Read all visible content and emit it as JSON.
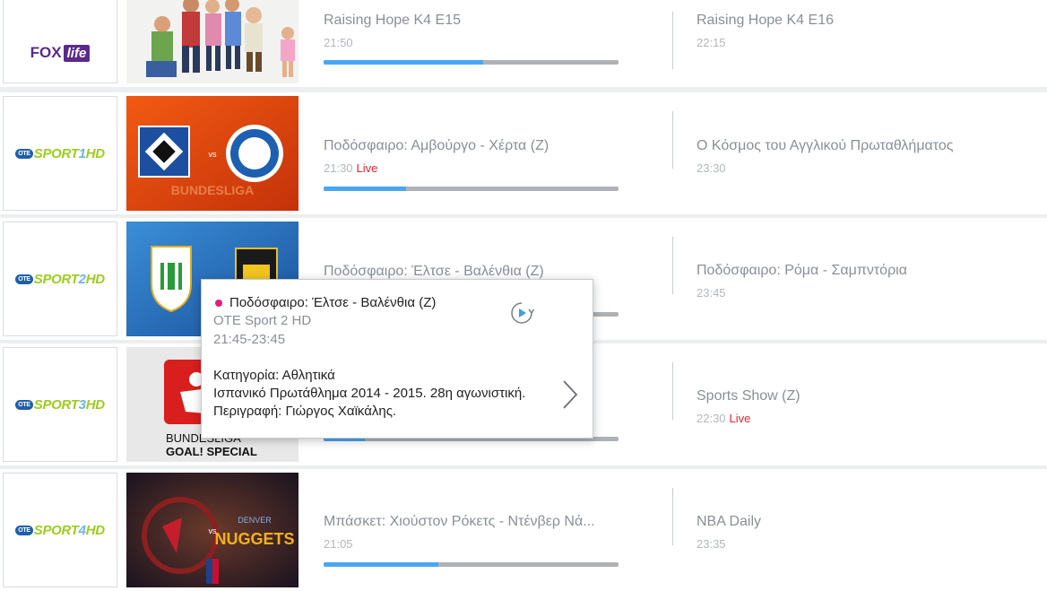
{
  "rows": [
    {
      "channel": "FOX life",
      "logo_type": "fox",
      "current": {
        "title": "Raising Hope K4 E15",
        "time": "21:50",
        "live": "",
        "progress": 0.54
      },
      "next": {
        "title": "Raising Hope K4 E16",
        "time": "22:15",
        "live": ""
      }
    },
    {
      "channel": "OTE SPORT 1 HD",
      "logo_type": "sport",
      "logo_num": "1",
      "current": {
        "title": "Ποδόσφαιρο: Αμβούργο - Χέρτα (Ζ)",
        "time": "21:30",
        "live": "Live",
        "progress": 0.28
      },
      "next": {
        "title": "Ο Κόσμος του Αγγλικού Πρωταθλήματος",
        "time": "23:30",
        "live": ""
      }
    },
    {
      "channel": "OTE SPORT 2 HD",
      "logo_type": "sport",
      "logo_num": "2",
      "current": {
        "title": "Ποδόσφαιρο: Έλτσε - Βαλένθια (Ζ)",
        "time": "",
        "live": "",
        "progress": 0.5
      },
      "next": {
        "title": "Ποδόσφαιρο: Ρόμα - Σαμπντόρια",
        "time": "23:45",
        "live": ""
      }
    },
    {
      "channel": "OTE SPORT 3 HD",
      "logo_type": "sport",
      "logo_num": "3",
      "current": {
        "title": "",
        "time": "",
        "live": "",
        "progress": 0.14
      },
      "next": {
        "title": "Sports Show (Ζ)",
        "time": "22:30",
        "live": "Live"
      }
    },
    {
      "channel": "OTE SPORT 4 HD",
      "logo_type": "sport",
      "logo_num": "4",
      "current": {
        "title": "Μπάσκετ: Χιούστον Ρόκετς - Ντένβερ Νά...",
        "time": "21:05",
        "live": "",
        "progress": 0.39
      },
      "next": {
        "title": "NBA Daily",
        "time": "23:35",
        "live": ""
      }
    }
  ],
  "logo_text": {
    "fox": "FOX",
    "life": "life",
    "ote": "OTE",
    "sport": "SPORT",
    "hd": "HD"
  },
  "thumb_text": {
    "bundesliga": "BUNDESLIGA",
    "vs": "vs",
    "nuggets": "NUGGETS",
    "denver": "DENVER",
    "goal": "BUNDESLIGA",
    "special": "GOAL! SPECIAL"
  },
  "popup": {
    "title": "Ποδόσφαιρο: Έλτσε - Βαλένθια (Ζ)",
    "channel": "OTE Sport 2 HD",
    "time_range": "21:45-23:45",
    "category": "Κατηγορία: Αθλητικά",
    "description": "Ισπανικό Πρωτάθλημα 2014 - 2015. 28η αγωνιστική. Περιγραφή: Γιώργος Χαϊκάλης."
  },
  "colors": {
    "progress_fill": "#4aa6f0",
    "progress_track": "#aeb2b6",
    "live": "#e4252d",
    "popup_dot": "#e0207a",
    "sport_green": "#9ccc1e",
    "fox_purple": "#5a2a8c"
  },
  "icons": {
    "replay": "replay-icon",
    "chevron": "chevron-right-icon"
  }
}
